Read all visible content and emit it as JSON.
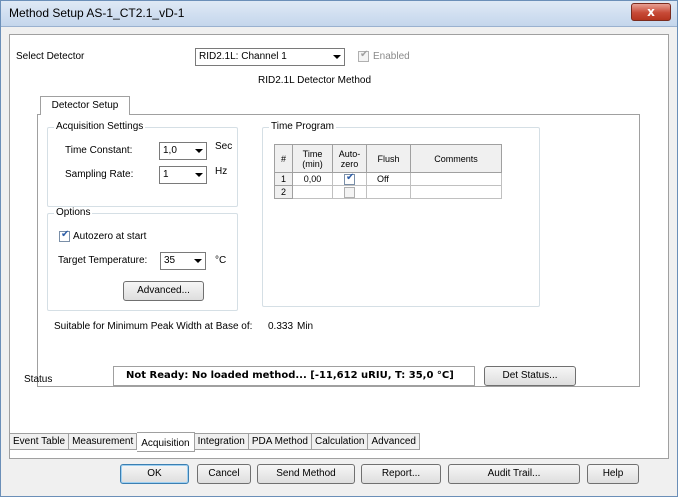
{
  "window": {
    "title": "Method Setup AS-1_CT2.1_vD-1",
    "close_glyph": "x"
  },
  "detector": {
    "label": "Select Detector",
    "selected": "RID2.1L: Channel 1",
    "enabled_label": "Enabled",
    "enabled_checked": true,
    "method_title": "RID2.1L Detector Method"
  },
  "detector_tab": {
    "label": "Detector Setup"
  },
  "acquisition": {
    "title": "Acquisition Settings",
    "time_constant_label": "Time Constant:",
    "time_constant_value": "1,0",
    "time_constant_unit": "Sec",
    "sampling_rate_label": "Sampling Rate:",
    "sampling_rate_value": "1",
    "sampling_rate_unit": "Hz"
  },
  "options": {
    "title": "Options",
    "autozero_label": "Autozero at start",
    "autozero_checked": true,
    "target_temp_label": "Target Temperature:",
    "target_temp_value": "35",
    "target_temp_unit": "°C",
    "advanced_button": "Advanced..."
  },
  "time_program": {
    "title": "Time Program",
    "columns": [
      "#",
      "Time\n(min)",
      "Auto-\nzero",
      "Flush",
      "Comments"
    ],
    "col_hash": "#",
    "col_time": "Time (min)",
    "col_time_line1": "Time",
    "col_time_line2": "(min)",
    "col_autozero_line1": "Auto-",
    "col_autozero_line2": "zero",
    "col_flush": "Flush",
    "col_comments": "Comments",
    "rows": [
      {
        "num": "1",
        "time": "0,00",
        "autozero": true,
        "flush": "Off",
        "comments": ""
      },
      {
        "num": "2",
        "time": "",
        "autozero": false,
        "flush": "",
        "comments": ""
      }
    ]
  },
  "peak_width": {
    "label": "Suitable for Minimum Peak Width at Base of:",
    "value": "0.333",
    "unit": "Min"
  },
  "status": {
    "label": "Status",
    "text": "Not Ready: No loaded method...  [-11,612 uRIU, T: 35,0 °C]",
    "det_status_button": "Det Status..."
  },
  "bottom_tabs": [
    {
      "label": "Event Table",
      "active": false
    },
    {
      "label": "Measurement",
      "active": false
    },
    {
      "label": "Acquisition",
      "active": true
    },
    {
      "label": "Integration",
      "active": false
    },
    {
      "label": "PDA Method",
      "active": false
    },
    {
      "label": "Calculation",
      "active": false
    },
    {
      "label": "Advanced",
      "active": false
    }
  ],
  "buttons": {
    "ok": "OK",
    "cancel": "Cancel",
    "send_method": "Send Method",
    "report": "Report...",
    "audit_trail": "Audit Trail...",
    "help": "Help"
  },
  "colors": {
    "title_gradient_top": "#dfe9f5",
    "close_red": "#c74a37",
    "checkmark_blue": "#2e5ea8"
  }
}
